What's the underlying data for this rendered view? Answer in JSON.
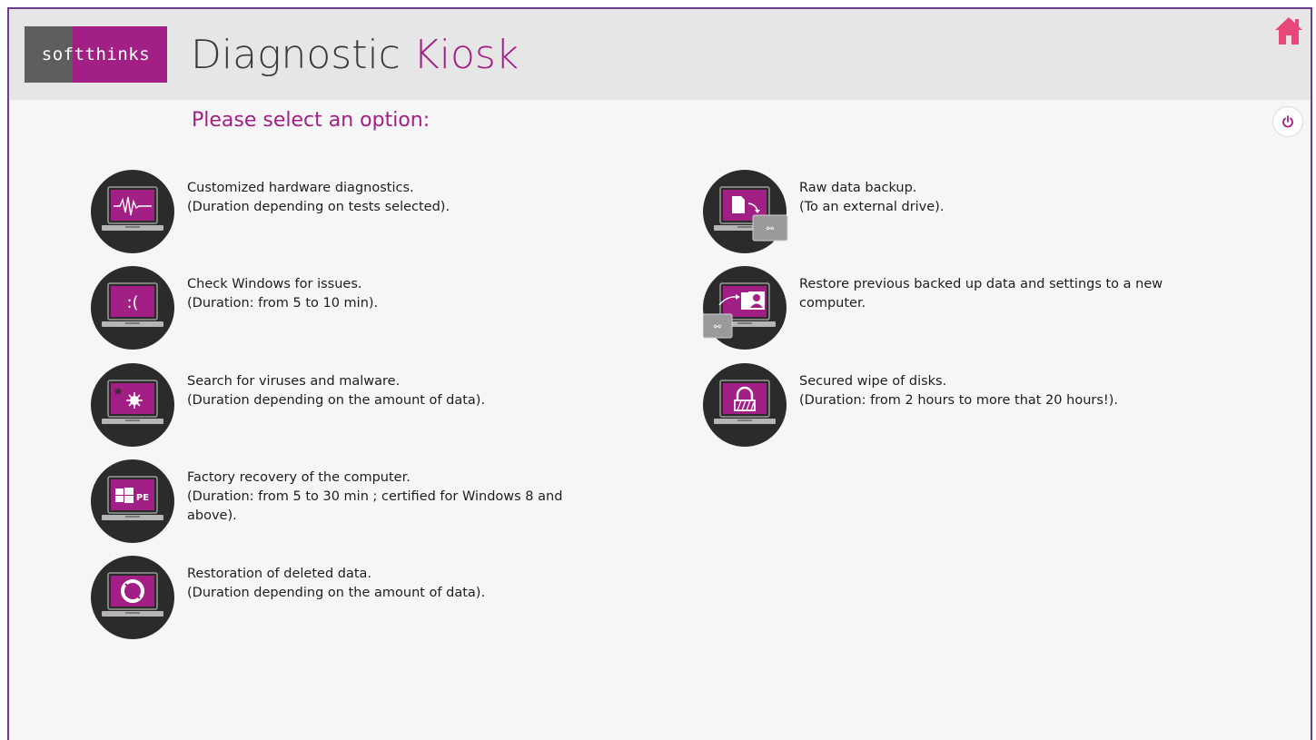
{
  "header": {
    "logo_text": "softthinks",
    "title_main": "Diagnostic",
    "title_accent": "Kiosk",
    "home_icon": "home-icon",
    "accent_color": "#a21f86"
  },
  "main": {
    "prompt": "Please select an option:",
    "power_icon": "power-icon"
  },
  "options_left": [
    {
      "icon": "hardware-diagnostics-icon",
      "line1": "Customized hardware diagnostics.",
      "line2": "(Duration depending on tests selected)."
    },
    {
      "icon": "windows-issues-icon",
      "line1": "Check Windows for issues.",
      "line2": "(Duration: from 5 to 10 min)."
    },
    {
      "icon": "virus-scan-icon",
      "line1": "Search for viruses and malware.",
      "line2": "(Duration depending on the amount of data)."
    },
    {
      "icon": "factory-recovery-icon",
      "line1": "Factory recovery of the computer.",
      "line2": "(Duration: from 5 to 30 min ; certified for Windows 8 and above)."
    },
    {
      "icon": "data-restoration-icon",
      "line1": "Restoration of deleted data.",
      "line2": "(Duration depending on the amount of data)."
    }
  ],
  "options_right": [
    {
      "icon": "raw-backup-icon",
      "line1": "Raw data backup.",
      "line2": "(To an external drive)."
    },
    {
      "icon": "restore-settings-icon",
      "line1": "Restore previous backed up data and settings to a new computer.",
      "line2": ""
    },
    {
      "icon": "secure-wipe-icon",
      "line1": "Secured wipe of disks.",
      "line2": "(Duration: from 2 hours to more that 20 hours!)."
    }
  ],
  "icon_labels": {
    "windows_face": ":(",
    "pe_label": "PE"
  }
}
